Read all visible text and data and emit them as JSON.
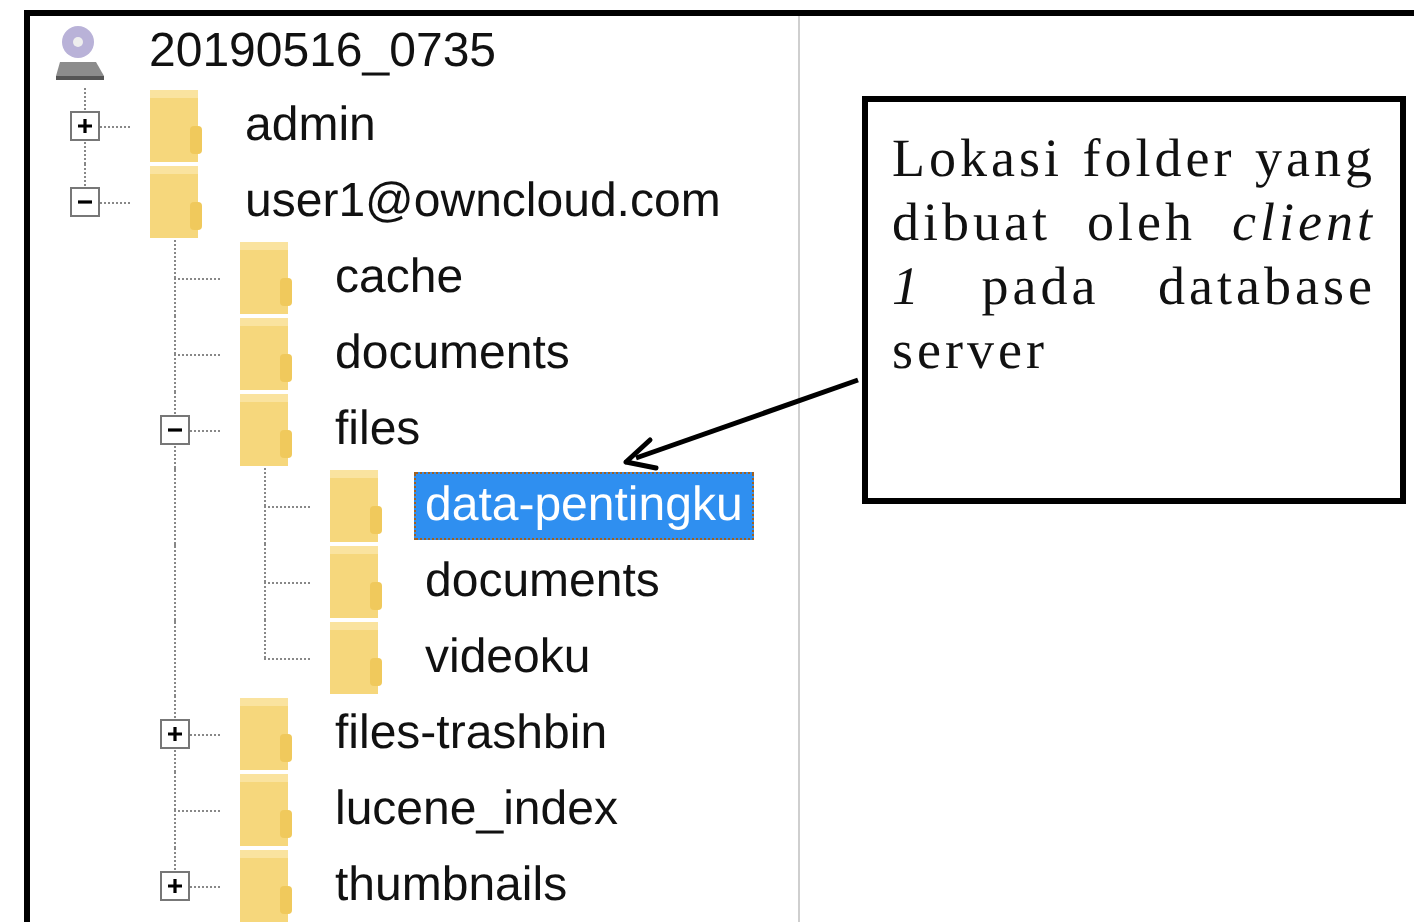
{
  "tree": {
    "label": "20190516_0735",
    "kind": "computer",
    "selected": false,
    "children": [
      {
        "label": "admin",
        "kind": "folder",
        "expanded": false,
        "selected": false
      },
      {
        "label": "user1@owncloud.com",
        "kind": "folder",
        "expanded": true,
        "selected": false,
        "children": [
          {
            "label": "cache",
            "kind": "folder",
            "selected": false
          },
          {
            "label": "documents",
            "kind": "folder",
            "selected": false
          },
          {
            "label": "files",
            "kind": "folder",
            "expanded": true,
            "selected": false,
            "children": [
              {
                "label": "data-pentingku",
                "kind": "folder",
                "selected": true
              },
              {
                "label": "documents",
                "kind": "folder",
                "selected": false
              },
              {
                "label": "videoku",
                "kind": "folder",
                "selected": false
              }
            ]
          },
          {
            "label": "files-trashbin",
            "kind": "folder",
            "expanded": false,
            "selected": false
          },
          {
            "label": "lucene_index",
            "kind": "folder",
            "selected": false
          },
          {
            "label": "thumbnails",
            "kind": "folder",
            "expanded": false,
            "selected": false
          }
        ]
      }
    ]
  },
  "callout": {
    "text": "Lokasi folder yang dibuat oleh *client 1* pada database server"
  }
}
